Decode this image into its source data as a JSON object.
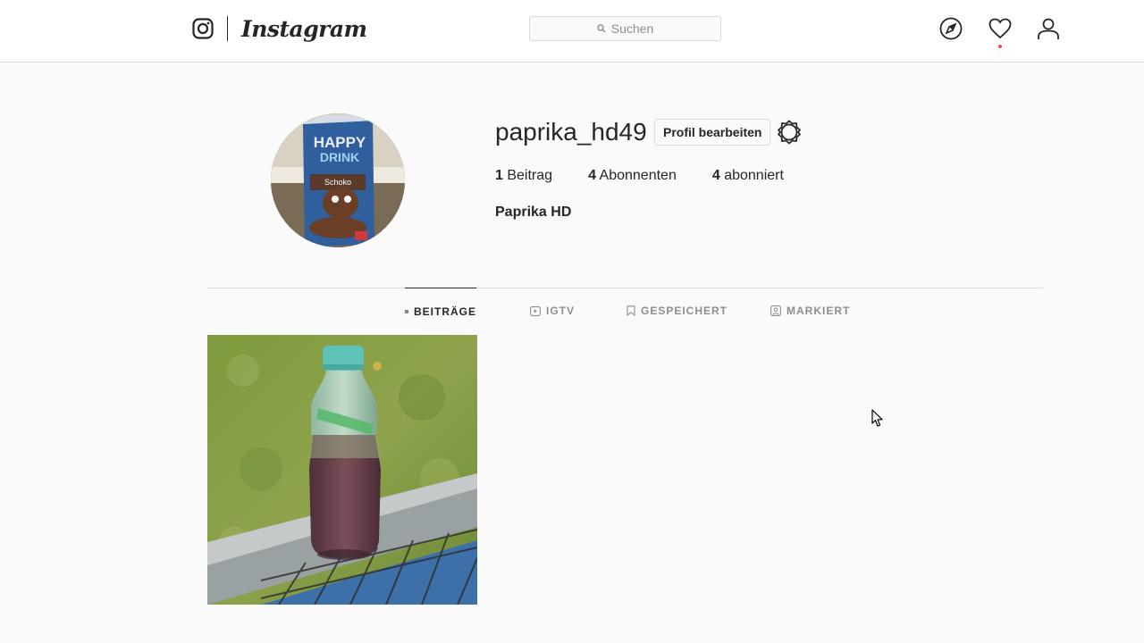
{
  "header": {
    "brand": "Instagram",
    "search_placeholder": "Suchen"
  },
  "profile": {
    "username": "paprika_hd49",
    "edit_button": "Profil bearbeiten",
    "full_name": "Paprika HD",
    "stats": {
      "posts_count": "1",
      "posts_label": "Beitrag",
      "followers_count": "4",
      "followers_label": "Abonnenten",
      "following_count": "4",
      "following_label": "abonniert"
    },
    "avatar_text": {
      "line1": "HAPPY",
      "line2": "DRINK",
      "line3": "Schoko"
    }
  },
  "tabs": [
    {
      "label": "BEITRÄGE",
      "icon": "grid-icon",
      "active": true
    },
    {
      "label": "IGTV",
      "icon": "igtv-icon",
      "active": false
    },
    {
      "label": "GESPEICHERT",
      "icon": "bookmark-icon",
      "active": false
    },
    {
      "label": "MARKIERT",
      "icon": "tagged-icon",
      "active": false
    }
  ],
  "colors": {
    "accent_dot": "#ed4956",
    "border": "#dbdbdb",
    "text": "#262626",
    "muted": "#8e8e8e"
  }
}
